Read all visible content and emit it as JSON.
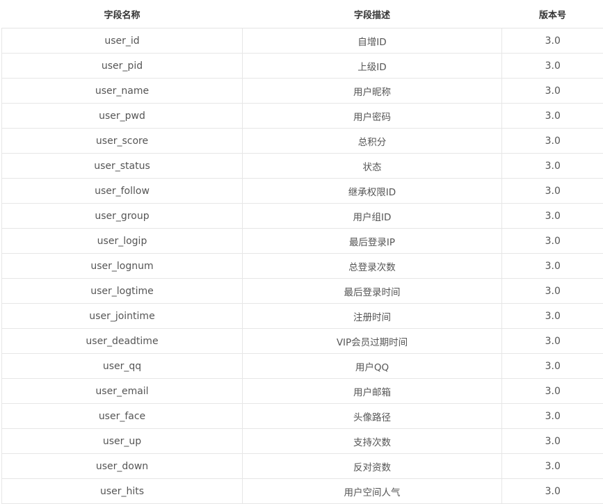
{
  "headers": {
    "field_name": "字段名称",
    "field_desc": "字段描述",
    "version": "版本号"
  },
  "rows": [
    {
      "field": "user_id",
      "desc": "自增ID",
      "version": "3.0"
    },
    {
      "field": "user_pid",
      "desc": "上级ID",
      "version": "3.0"
    },
    {
      "field": "user_name",
      "desc": "用户昵称",
      "version": "3.0"
    },
    {
      "field": "user_pwd",
      "desc": "用户密码",
      "version": "3.0"
    },
    {
      "field": "user_score",
      "desc": "总积分",
      "version": "3.0"
    },
    {
      "field": "user_status",
      "desc": "状态",
      "version": "3.0"
    },
    {
      "field": "user_follow",
      "desc": "继承权限ID",
      "version": "3.0"
    },
    {
      "field": "user_group",
      "desc": "用户组ID",
      "version": "3.0"
    },
    {
      "field": "user_logip",
      "desc": "最后登录IP",
      "version": "3.0"
    },
    {
      "field": "user_lognum",
      "desc": "总登录次数",
      "version": "3.0"
    },
    {
      "field": "user_logtime",
      "desc": "最后登录时间",
      "version": "3.0"
    },
    {
      "field": "user_jointime",
      "desc": "注册时间",
      "version": "3.0"
    },
    {
      "field": "user_deadtime",
      "desc": "VIP会员过期时间",
      "version": "3.0"
    },
    {
      "field": "user_qq",
      "desc": "用户QQ",
      "version": "3.0"
    },
    {
      "field": "user_email",
      "desc": "用户邮箱",
      "version": "3.0"
    },
    {
      "field": "user_face",
      "desc": "头像路径",
      "version": "3.0"
    },
    {
      "field": "user_up",
      "desc": "支持次数",
      "version": "3.0"
    },
    {
      "field": "user_down",
      "desc": "反对资数",
      "version": "3.0"
    },
    {
      "field": "user_hits",
      "desc": "用户空间人气",
      "version": "3.0"
    }
  ]
}
